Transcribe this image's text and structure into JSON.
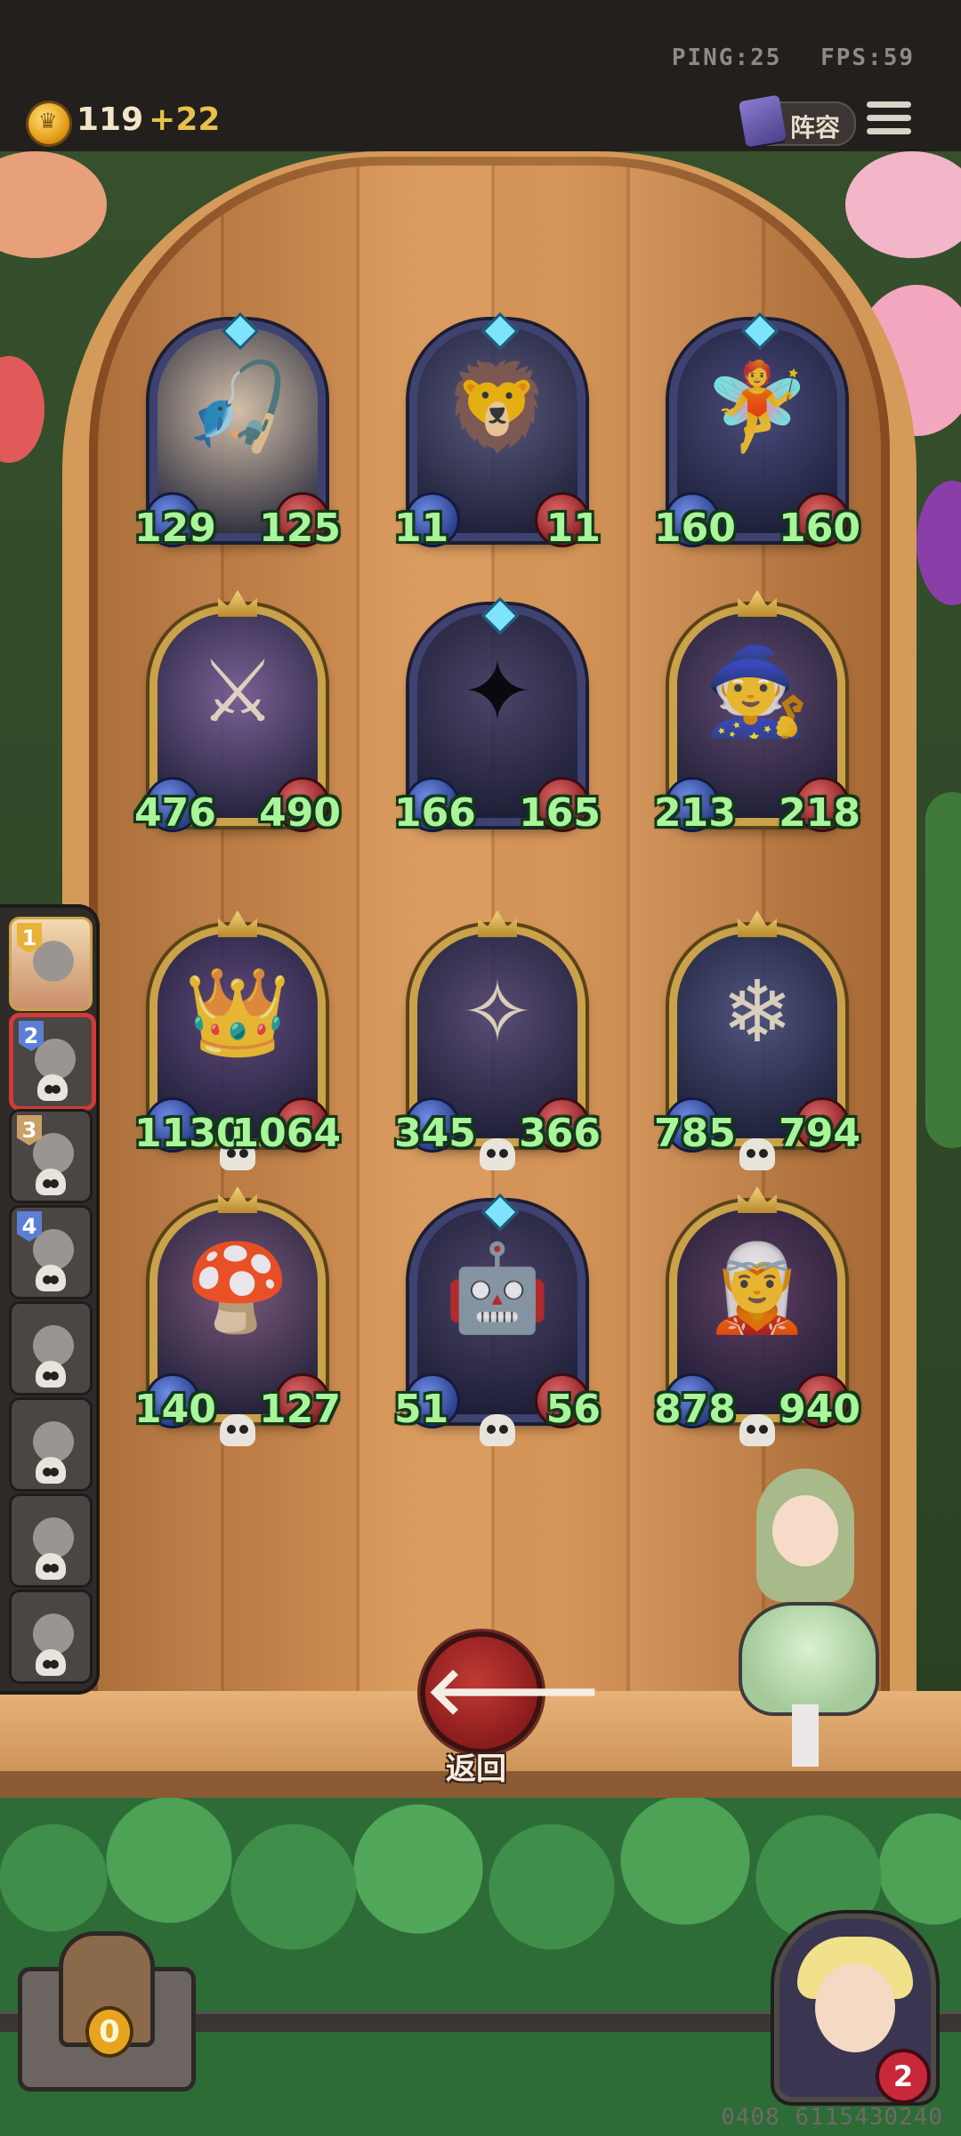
{
  "hud": {
    "ping": "PING:25",
    "fps": "FPS:59",
    "gold": "119",
    "gold_gain": "+22",
    "lineup_label": "阵容"
  },
  "board": {
    "minions": [
      {
        "name": "fisherman",
        "attack": "129",
        "health": "125",
        "frame": "blue",
        "glyph": "🎣",
        "art_color": "#d8d0c2"
      },
      {
        "name": "golden-lion",
        "attack": "11",
        "health": "11",
        "frame": "blue",
        "glyph": "🦁",
        "art_color": "#3a4a86"
      },
      {
        "name": "fairy",
        "attack": "160",
        "health": "160",
        "frame": "blue",
        "glyph": "🧚",
        "art_color": "#2f3f8a"
      },
      {
        "name": "golden-warriors",
        "attack": "476",
        "health": "490",
        "frame": "gold",
        "glyph": "⚔",
        "art_color": "#6a5aa8"
      },
      {
        "name": "sorceress",
        "attack": "166",
        "health": "165",
        "frame": "blue",
        "glyph": "✦",
        "art_color": "#2a2f6a"
      },
      {
        "name": "shadow-wizard",
        "attack": "213",
        "health": "218",
        "frame": "gold",
        "glyph": "🧙",
        "art_color": "#4a3d78"
      },
      {
        "name": "king",
        "attack": "1130",
        "health": "1064",
        "frame": "gold",
        "glyph": "👑",
        "art_color": "#4a3f8a"
      },
      {
        "name": "blue-witch",
        "attack": "345",
        "health": "366",
        "frame": "gold",
        "glyph": "✧",
        "art_color": "#3a3a7a"
      },
      {
        "name": "frost-beast",
        "attack": "785",
        "health": "794",
        "frame": "gold",
        "glyph": "❄",
        "art_color": "#344a8a"
      },
      {
        "name": "mushroom-creature",
        "attack": "140",
        "health": "127",
        "frame": "gold",
        "glyph": "🍄",
        "art_color": "#6a4f8a"
      },
      {
        "name": "space-mech",
        "attack": "51",
        "health": "56",
        "frame": "blue",
        "glyph": "🤖",
        "art_color": "#2a2f6a"
      },
      {
        "name": "elf-queen",
        "attack": "878",
        "health": "940",
        "frame": "gold",
        "glyph": "🧝",
        "art_color": "#4a2f6a"
      }
    ]
  },
  "queue": {
    "slots": [
      {
        "label": "1",
        "state": "first"
      },
      {
        "label": "2",
        "state": "selected"
      },
      {
        "label": "3",
        "state": "plain"
      },
      {
        "label": "4",
        "state": "normal"
      },
      {
        "label": "",
        "state": "normal"
      },
      {
        "label": "",
        "state": "normal"
      },
      {
        "label": "",
        "state": "normal"
      },
      {
        "label": "",
        "state": "normal"
      }
    ]
  },
  "back_button": {
    "label": "返回"
  },
  "chest": {
    "count": "0"
  },
  "portrait": {
    "badge": "2"
  },
  "footer": {
    "code": "0408 6115430240"
  }
}
